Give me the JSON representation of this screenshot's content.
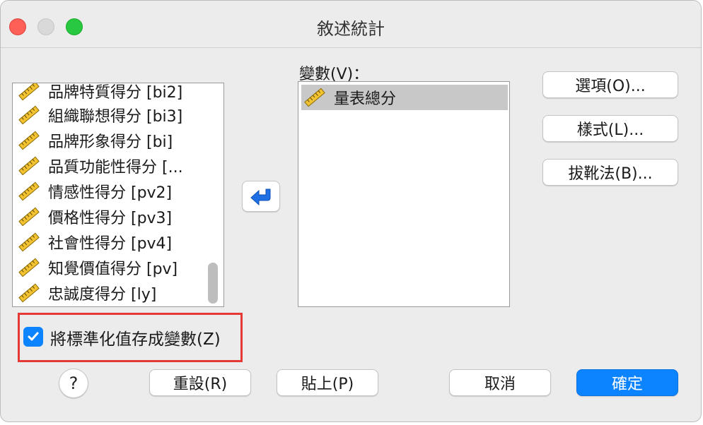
{
  "window": {
    "title": "敘述統計"
  },
  "source_list": {
    "items": [
      {
        "label": "品牌特質得分 [bi2]"
      },
      {
        "label": "組織聯想得分 [bi3]"
      },
      {
        "label": "品牌形象得分 [bi]"
      },
      {
        "label": "品質功能性得分 [..."
      },
      {
        "label": "情感性得分 [pv2]"
      },
      {
        "label": "價格性得分 [pv3]"
      },
      {
        "label": "社會性得分 [pv4]"
      },
      {
        "label": "知覺價值得分 [pv]"
      },
      {
        "label": "忠誠度得分 [ly]"
      }
    ]
  },
  "variables": {
    "label": "變數(V)：",
    "items": [
      {
        "label": "量表總分"
      }
    ]
  },
  "side_buttons": {
    "options": "選項(O)...",
    "style": "樣式(L)...",
    "bootstrap": "拔靴法(B)..."
  },
  "standardize": {
    "label": "將標準化值存成變數(Z)",
    "checked": true
  },
  "footer": {
    "help": "?",
    "reset": "重設(R)",
    "paste": "貼上(P)",
    "cancel": "取消",
    "ok": "確定"
  },
  "colors": {
    "accent": "#0d84ff",
    "highlight": "#e53935",
    "selected_row": "#c8c8c8"
  },
  "icons": {
    "variable": "ruler-scale-icon",
    "move": "arrow-left-icon"
  }
}
